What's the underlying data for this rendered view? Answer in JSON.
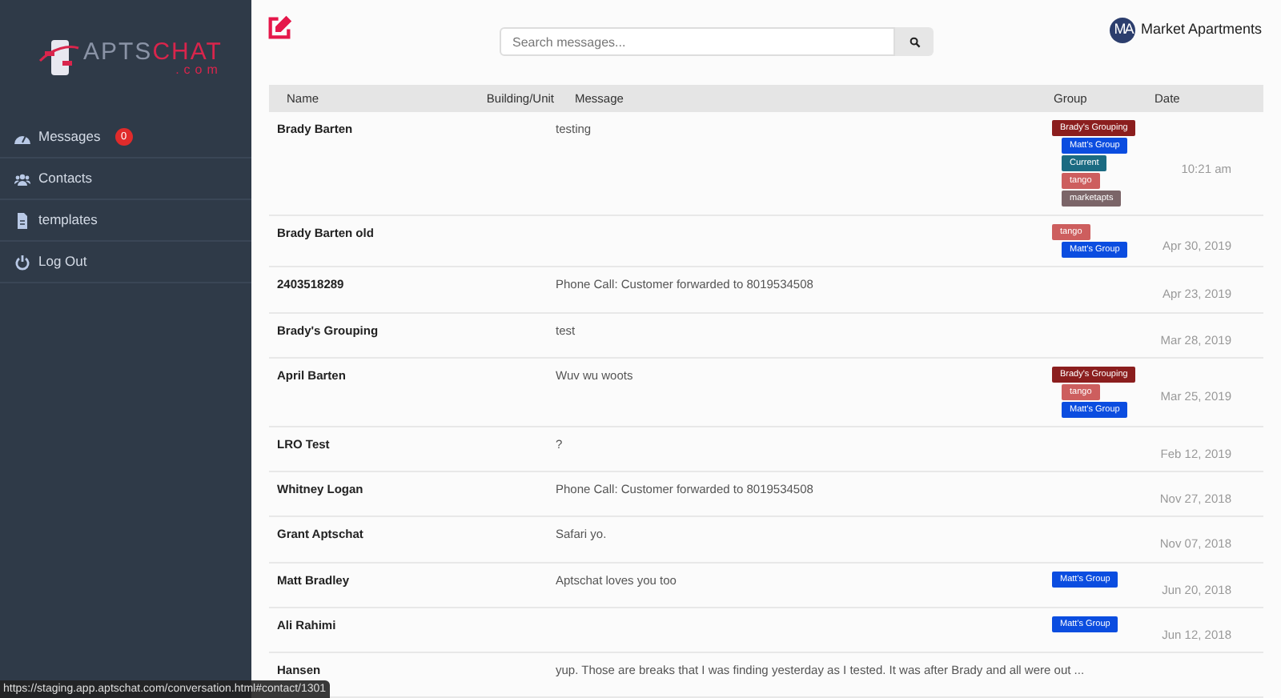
{
  "sidebar": {
    "logo": {
      "brand_a": "APTS",
      "brand_b": "CHAT",
      "domain": ".com"
    },
    "items": [
      {
        "label": "Messages",
        "badge": "0"
      },
      {
        "label": "Contacts"
      },
      {
        "label": "templates"
      },
      {
        "label": "Log Out"
      }
    ]
  },
  "search": {
    "placeholder": "Search messages..."
  },
  "account": {
    "initials": "MA",
    "name": "Market Apartments"
  },
  "table": {
    "columns": [
      "Name",
      "Building/Unit",
      "Message",
      "Group",
      "Date"
    ],
    "rows": [
      {
        "name": "Brady Barten",
        "message": "testing",
        "date": "10:21 am",
        "groups": [
          {
            "label": "Brady's Grouping",
            "color": "#8b1e1e"
          },
          {
            "label": "Matt's Group",
            "color": "#0b4de0"
          },
          {
            "label": "Current",
            "color": "#1b6b82"
          },
          {
            "label": "tango",
            "color": "#cd5e5e"
          },
          {
            "label": "marketapts",
            "color": "#7b6568"
          }
        ]
      },
      {
        "name": "Brady Barten old",
        "date": "Apr 30, 2019",
        "groups": [
          {
            "label": "tango",
            "color": "#cd5e5e"
          },
          {
            "label": "Matt's Group",
            "color": "#0b4de0"
          }
        ]
      },
      {
        "name": "2403518289",
        "message": "Phone Call: Customer forwarded to 8019534508",
        "date": "Apr 23, 2019"
      },
      {
        "name": "Brady's Grouping",
        "message": "test",
        "date": "Mar 28, 2019"
      },
      {
        "name": "April Barten",
        "message": "Wuv wu woots",
        "date": "Mar 25, 2019",
        "groups": [
          {
            "label": "Brady's Grouping",
            "color": "#8b1e1e"
          },
          {
            "label": "tango",
            "color": "#cd5e5e"
          },
          {
            "label": "Matt's Group",
            "color": "#0b4de0"
          }
        ]
      },
      {
        "name": "LRO Test",
        "message": "?",
        "date": "Feb 12, 2019"
      },
      {
        "name": "Whitney Logan",
        "message": "Phone Call: Customer forwarded to 8019534508",
        "date": "Nov 27, 2018"
      },
      {
        "name": "Grant Aptschat",
        "message": "Safari yo.",
        "date": "Nov 07, 2018"
      },
      {
        "name": "Matt Bradley",
        "message": "Aptschat loves you too",
        "date": "Jun 20, 2018",
        "groups": [
          {
            "label": "Matt's Group",
            "color": "#0b4de0"
          }
        ]
      },
      {
        "name": "Ali Rahimi",
        "date": "Jun 12, 2018",
        "groups": [
          {
            "label": "Matt's Group",
            "color": "#0b4de0"
          }
        ]
      },
      {
        "name": "Hansen",
        "message": "yup. Those are breaks that I was finding yesterday as I tested. It was after Brady and all were out ..."
      }
    ]
  },
  "status_bar": {
    "url": "https://staging.app.aptschat.com/conversation.html#contact/1301"
  }
}
